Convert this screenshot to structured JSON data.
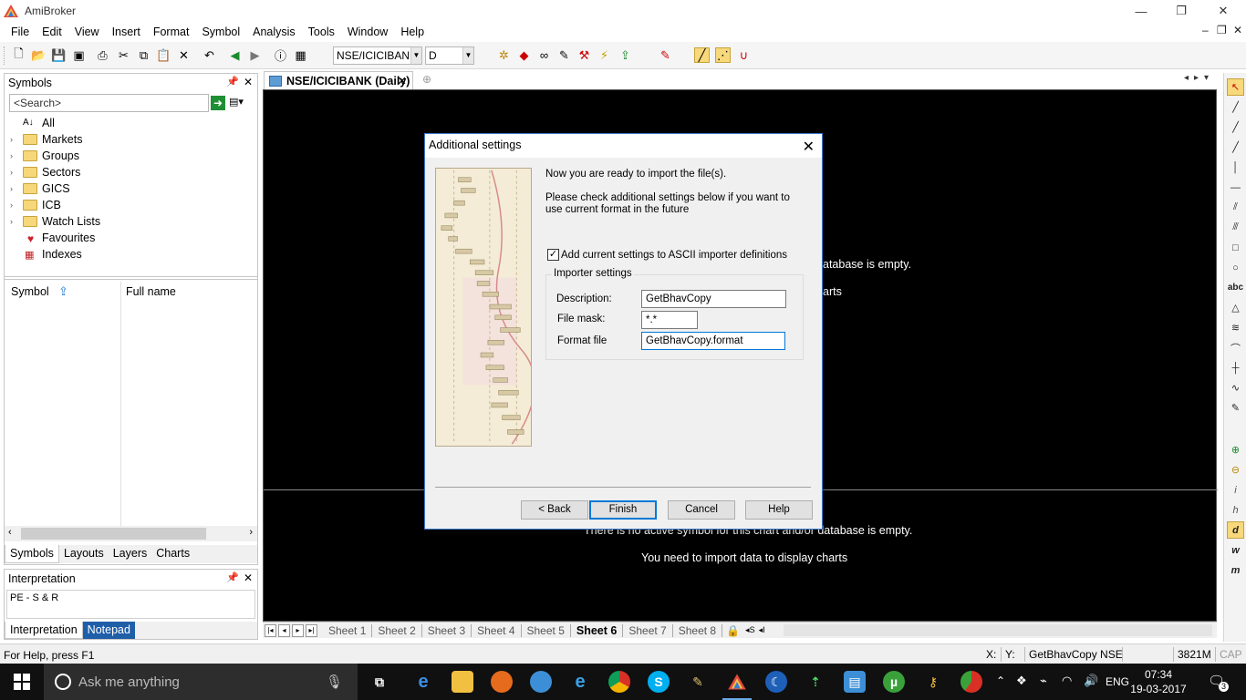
{
  "window": {
    "title": "AmiBroker",
    "controls": [
      "minimize",
      "restore",
      "close"
    ]
  },
  "menu": {
    "items": [
      "File",
      "Edit",
      "View",
      "Insert",
      "Format",
      "Symbol",
      "Analysis",
      "Tools",
      "Window",
      "Help"
    ],
    "mdi_controls": [
      "–",
      "❐",
      "✕"
    ]
  },
  "toolbar": {
    "symbol_combo": "NSE/ICICIBANK",
    "interval_combo": "D"
  },
  "symbols_panel": {
    "title": "Symbols",
    "search_placeholder": "<Search>",
    "tree": [
      {
        "label": "All",
        "icon": "sort-az-icon",
        "expandable": false
      },
      {
        "label": "Markets",
        "icon": "folder-icon",
        "expandable": true
      },
      {
        "label": "Groups",
        "icon": "folder-icon",
        "expandable": true
      },
      {
        "label": "Sectors",
        "icon": "folder-icon",
        "expandable": true
      },
      {
        "label": "GICS",
        "icon": "folder-icon",
        "expandable": true
      },
      {
        "label": "ICB",
        "icon": "folder-icon",
        "expandable": true
      },
      {
        "label": "Watch Lists",
        "icon": "folder-icon",
        "expandable": true
      },
      {
        "label": "Favourites",
        "icon": "heart-icon",
        "expandable": false
      },
      {
        "label": "Indexes",
        "icon": "index-icon",
        "expandable": false
      }
    ],
    "columns": [
      "Symbol",
      "Full name"
    ],
    "tabs": [
      "Symbols",
      "Layouts",
      "Layers",
      "Charts"
    ]
  },
  "interpretation_panel": {
    "title": "Interpretation",
    "text": "PE - S & R",
    "tabs": [
      "Interpretation",
      "Notepad"
    ]
  },
  "document_tab": {
    "label": "NSE/ICICIBANK (Daily)"
  },
  "chart": {
    "msg_top_1_fragment": "atabase is empty.",
    "msg_top_2_fragment": "arts",
    "msg_bottom_1": "There is no active symbol for this chart and/or database is empty.",
    "msg_bottom_2": "You need to import data to display charts"
  },
  "sheets": {
    "items": [
      "Sheet 1",
      "Sheet 2",
      "Sheet 3",
      "Sheet 4",
      "Sheet 5",
      "Sheet 6",
      "Sheet 7",
      "Sheet 8"
    ],
    "active": "Sheet 6"
  },
  "statusbar": {
    "help": "For Help, press F1",
    "x": "X:",
    "y": "Y:",
    "db": "GetBhavCopy NSE",
    "mem": "3821M",
    "cap": "CAP"
  },
  "dialog": {
    "title": "Additional settings",
    "intro": "Now you are ready to import the file(s).",
    "instructions": "Please check additional settings below if you want to use current format in the future",
    "checkbox_label": "Add current settings to ASCII importer definitions",
    "checkbox_checked": true,
    "group_title": "Importer settings",
    "description_label": "Description:",
    "description_value": "GetBhavCopy",
    "filemask_label": "File mask:",
    "filemask_value": "*.*",
    "formatfile_label": "Format file",
    "formatfile_value": "GetBhavCopy.format",
    "buttons": {
      "back": "< Back",
      "finish": "Finish",
      "cancel": "Cancel",
      "help": "Help"
    }
  },
  "taskbar": {
    "search_placeholder": "Ask me anything",
    "language": "ENG",
    "time": "07:34",
    "date": "19-03-2017",
    "notification_count": "3"
  },
  "colors": {
    "chart_bg": "#000000",
    "dialog_accent": "#0078d7",
    "taskbar_bg": "#101010"
  }
}
